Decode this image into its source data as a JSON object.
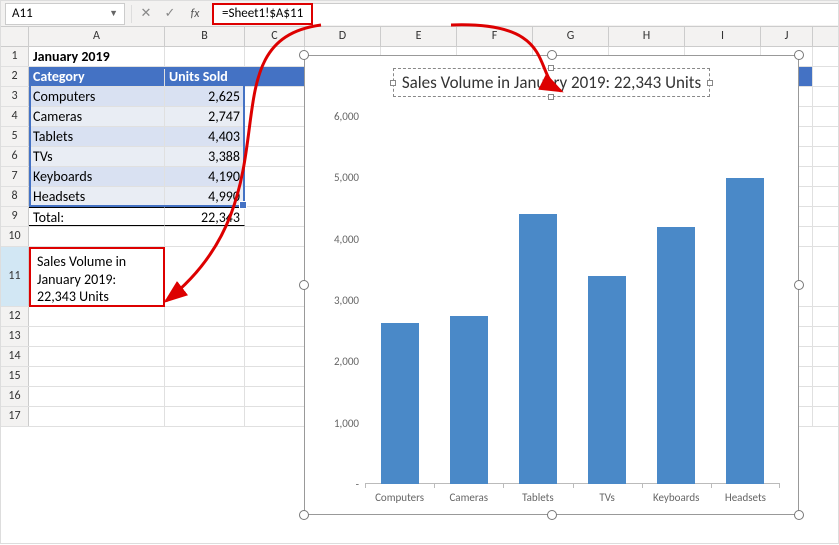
{
  "name_box": "A11",
  "formula": "=Sheet1!$A$11",
  "columns": [
    "A",
    "B",
    "C",
    "D",
    "E",
    "F",
    "G",
    "H",
    "I",
    "J"
  ],
  "table": {
    "title": "January 2019",
    "headers": [
      "Category",
      "Units Sold"
    ],
    "rows": [
      {
        "cat": "Computers",
        "val": "2,625"
      },
      {
        "cat": "Cameras",
        "val": "2,747"
      },
      {
        "cat": "Tablets",
        "val": "4,403"
      },
      {
        "cat": "TVs",
        "val": "3,388"
      },
      {
        "cat": "Keyboards",
        "val": "4,190"
      },
      {
        "cat": "Headsets",
        "val": "4,990"
      }
    ],
    "total_label": "Total:",
    "total_value": "22,343"
  },
  "a11_text": "Sales Volume in January 2019: 22,343 Units",
  "chart_title": "Sales Volume in January 2019: 22,343 Units",
  "chart_data": {
    "type": "bar",
    "categories": [
      "Computers",
      "Cameras",
      "Tablets",
      "TVs",
      "Keyboards",
      "Headsets"
    ],
    "values": [
      2625,
      2747,
      4403,
      3388,
      4190,
      4990
    ],
    "title": "Sales Volume in January 2019: 22,343 Units",
    "xlabel": "",
    "ylabel": "",
    "ylim": [
      0,
      6000
    ],
    "yticks": [
      0,
      1000,
      2000,
      3000,
      4000,
      5000,
      6000
    ],
    "ytick_labels": [
      "-",
      "1,000",
      "2,000",
      "3,000",
      "4,000",
      "5,000",
      "6,000"
    ]
  }
}
